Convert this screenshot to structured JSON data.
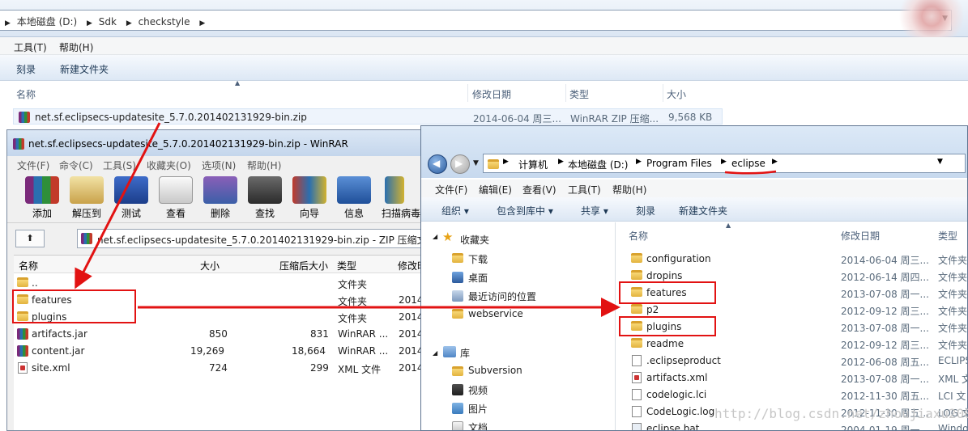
{
  "bg_explorer": {
    "breadcrumbs": [
      "本地磁盘 (D:)",
      "Sdk",
      "checkstyle"
    ],
    "menu": [
      "工具(T)",
      "帮助(H)"
    ],
    "toolbar": [
      "刻录",
      "新建文件夹"
    ],
    "columns": [
      "名称",
      "修改日期",
      "类型",
      "大小"
    ],
    "row": {
      "name": "net.sf.eclipsecs-updatesite_5.7.0.201402131929-bin.zip",
      "date": "2014-06-04 周三...",
      "type": "WinRAR ZIP 压缩...",
      "size": "9,568 KB"
    }
  },
  "winrar": {
    "title": "net.sf.eclipsecs-updatesite_5.7.0.201402131929-bin.zip - WinRAR",
    "menu": [
      "文件(F)",
      "命令(C)",
      "工具(S)",
      "收藏夹(O)",
      "选项(N)",
      "帮助(H)"
    ],
    "tools": [
      "添加",
      "解压到",
      "测试",
      "查看",
      "删除",
      "查找",
      "向导",
      "信息",
      "扫描病毒"
    ],
    "path": "net.sf.eclipsecs-updatesite_5.7.0.201402131929-bin.zip - ZIP 压缩文件,",
    "columns": [
      "名称",
      "大小",
      "压缩后大小",
      "类型",
      "修改时"
    ],
    "rows": [
      {
        "name": "..",
        "size": "",
        "packed": "",
        "type": "文件夹",
        "mod": ""
      },
      {
        "name": "features",
        "size": "",
        "packed": "",
        "type": "文件夹",
        "mod": "2014"
      },
      {
        "name": "plugins",
        "size": "",
        "packed": "",
        "type": "文件夹",
        "mod": "2014"
      },
      {
        "name": "artifacts.jar",
        "size": "850",
        "packed": "831",
        "type": "WinRAR ...",
        "mod": "2014"
      },
      {
        "name": "content.jar",
        "size": "19,269",
        "packed": "18,664",
        "type": "WinRAR ...",
        "mod": "2014"
      },
      {
        "name": "site.xml",
        "size": "724",
        "packed": "299",
        "type": "XML 文件",
        "mod": "2014"
      }
    ]
  },
  "explorer": {
    "breadcrumbs": [
      "计算机",
      "本地磁盘 (D:)",
      "Program Files",
      "eclipse"
    ],
    "menu": [
      "文件(F)",
      "编辑(E)",
      "查看(V)",
      "工具(T)",
      "帮助(H)"
    ],
    "toolbar": [
      "组织 ▾",
      "包含到库中 ▾",
      "共享 ▾",
      "刻录",
      "新建文件夹"
    ],
    "nav": {
      "favorites": "收藏夹",
      "fav_items": [
        "下载",
        "桌面",
        "最近访问的位置",
        "webservice"
      ],
      "library": "库",
      "lib_items": [
        "Subversion",
        "视频",
        "图片",
        "文档"
      ]
    },
    "columns": [
      "名称",
      "修改日期",
      "类型"
    ],
    "rows": [
      {
        "name": "configuration",
        "date": "2014-06-04 周三...",
        "type": "文件夹"
      },
      {
        "name": "dropins",
        "date": "2012-06-14 周四...",
        "type": "文件夹"
      },
      {
        "name": "features",
        "date": "2013-07-08 周一...",
        "type": "文件夹"
      },
      {
        "name": "p2",
        "date": "2012-09-12 周三...",
        "type": "文件夹"
      },
      {
        "name": "plugins",
        "date": "2013-07-08 周一...",
        "type": "文件夹"
      },
      {
        "name": "readme",
        "date": "2012-09-12 周三...",
        "type": "文件夹"
      },
      {
        "name": ".eclipseproduct",
        "date": "2012-06-08 周五...",
        "type": "ECLIPS"
      },
      {
        "name": "artifacts.xml",
        "date": "2013-07-08 周一...",
        "type": "XML 文"
      },
      {
        "name": "codelogic.lci",
        "date": "2012-11-30 周五...",
        "type": "LCI 文"
      },
      {
        "name": "CodeLogic.log",
        "date": "2012-11-30 周五...",
        "type": "LOG 文"
      },
      {
        "name": "eclipse.bat",
        "date": "2004-01-19 周一...",
        "type": "Windo"
      }
    ]
  },
  "watermark": "http://blog.csdn.net/zhoujiaxu2008",
  "colors": {
    "annotation_red": "#e21212"
  }
}
